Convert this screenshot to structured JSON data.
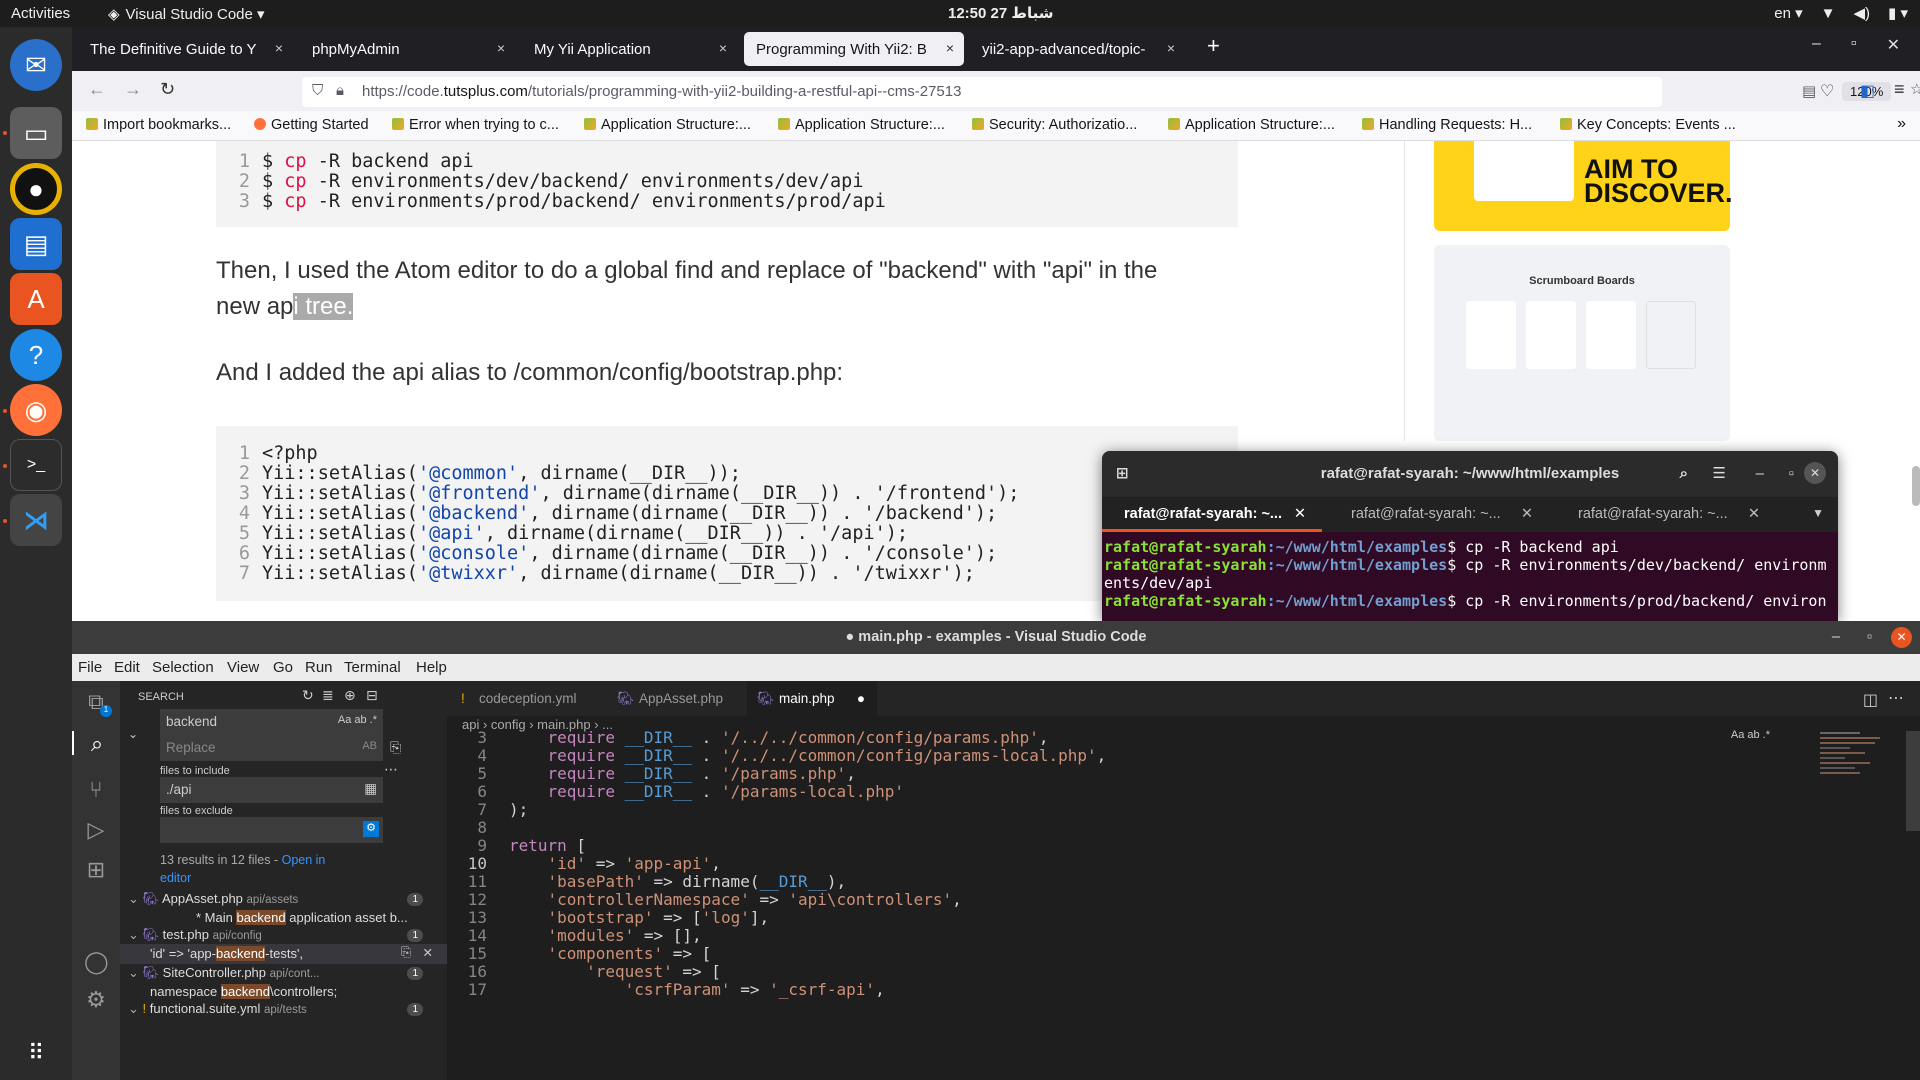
{
  "topbar": {
    "activities": "Activities",
    "app_name": "Visual Studio Code ▾",
    "clock": "12:50 27 شباط",
    "lang": "en ▾"
  },
  "firefox": {
    "tabs": [
      {
        "label": "The Definitive Guide to Y",
        "close": "×"
      },
      {
        "label": "phpMyAdmin",
        "close": "×"
      },
      {
        "label": "My Yii Application",
        "close": "×"
      },
      {
        "label": "Programming With Yii2: B",
        "close": "×"
      },
      {
        "label": "yii2-app-advanced/topic-",
        "close": "×"
      }
    ],
    "url_prefix": "https://code.",
    "url_domain": "tutsplus.com",
    "url_path": "/tutorials/programming-with-yii2-building-a-restful-api--cms-27513",
    "zoom": "120%",
    "bookmarks": [
      "Import bookmarks...",
      "Getting Started",
      "Error when trying to c...",
      "Application Structure:...",
      "Application Structure:...",
      "Security: Authorizatio...",
      "Application Structure:...",
      "Handling Requests: H...",
      "Key Concepts: Events ..."
    ]
  },
  "article": {
    "code1": [
      {
        "n": "1",
        "cmd": "cp",
        "args": " -R backend api"
      },
      {
        "n": "2",
        "cmd": "cp",
        "args": " -R environments/dev/backend/ environments/dev/api"
      },
      {
        "n": "3",
        "cmd": "cp",
        "args": " -R environments/prod/backend/ environments/prod/api"
      }
    ],
    "p1_a": "Then, I used the Atom editor to do a global find and replace of \"backend\" with \"api\" in the",
    "p1_b": "new ap",
    "p1_sel": "i tree.",
    "p2": "And I added the api alias to /common/config/bootstrap.php:",
    "code2": [
      {
        "n": "1",
        "pre": "<?php",
        "str": "",
        "post": ""
      },
      {
        "n": "2",
        "pre": "Yii::setAlias(",
        "str": "'@common'",
        "post": ", dirname(__DIR__));"
      },
      {
        "n": "3",
        "pre": "Yii::setAlias(",
        "str": "'@frontend'",
        "post": ", dirname(dirname(__DIR__)) . '/frontend');"
      },
      {
        "n": "4",
        "pre": "Yii::setAlias(",
        "str": "'@backend'",
        "post": ", dirname(dirname(__DIR__)) . '/backend');"
      },
      {
        "n": "5",
        "pre": "Yii::setAlias(",
        "str": "'@api'",
        "post": ", dirname(dirname(__DIR__)) . '/api');"
      },
      {
        "n": "6",
        "pre": "Yii::setAlias(",
        "str": "'@console'",
        "post": ", dirname(dirname(__DIR__)) . '/console');"
      },
      {
        "n": "7",
        "pre": "Yii::setAlias(",
        "str": "'@twixxr'",
        "post": ", dirname(dirname(__DIR__)) . '/twixxr');"
      }
    ],
    "ad1_text": "AIM TO DISCOVER.",
    "ad2_title": "Scrumboard Boards"
  },
  "terminal": {
    "title": "rafat@rafat-syarah: ~/www/html/examples",
    "tabs": [
      "rafat@rafat-syarah: ~...",
      "rafat@rafat-syarah: ~...",
      "rafat@rafat-syarah: ~..."
    ],
    "user": "rafat@rafat-syarah",
    "path": ":~/www/html/examples",
    "lines": [
      "$ cp -R backend api",
      "$ cp -R environments/dev/backend/ environm",
      "$ cp -R environments/prod/backend/ environ"
    ],
    "wrap": "ents/dev/api"
  },
  "vscode": {
    "title": "● main.php - examples - Visual Studio Code",
    "menu": [
      "File",
      "Edit",
      "Selection",
      "View",
      "Go",
      "Run",
      "Terminal",
      "Help"
    ],
    "search": {
      "header": "SEARCH",
      "query": "backend",
      "replace_placeholder": "Replace",
      "include_label": "files to include",
      "include_value": "./api",
      "exclude_label": "files to exclude",
      "summary": "13 results in 12 files - ",
      "open_editor": "Open in editor",
      "results": [
        {
          "file": "AppAsset.php",
          "path": "api/assets",
          "count": "1",
          "match_pre": "* Main ",
          "match_hl": "backend",
          "match_post": " application asset b..."
        },
        {
          "file": "test.php",
          "path": "api/config",
          "count": "1",
          "match_pre": "'id' => 'app-",
          "match_hl": "backend",
          "match_post": "-tests',"
        },
        {
          "file": "SiteController.php",
          "path": "api/cont...",
          "count": "1",
          "match_pre": "namespace ",
          "match_hl": "backend",
          "match_post": "\\controllers;"
        },
        {
          "file": "functional.suite.yml",
          "path": "api/tests",
          "count": "1",
          "match_pre": "",
          "match_hl": "",
          "match_post": ""
        }
      ]
    },
    "tabs": [
      "codeception.yml",
      "AppAsset.php",
      "main.php"
    ],
    "breadcrumb": "api  ›  config  ›  main.php  › ...",
    "code": [
      {
        "n": "3",
        "html": "    <span class='k'>require</span> <span class='c'>__DIR__</span> . <span class='s'>'/../../common/config/params.php'</span>,"
      },
      {
        "n": "4",
        "html": "    <span class='k'>require</span> <span class='c'>__DIR__</span> . <span class='s'>'/../../common/config/params-local.php'</span>,"
      },
      {
        "n": "5",
        "html": "    <span class='k'>require</span> <span class='c'>__DIR__</span> . <span class='s'>'/params.php'</span>,"
      },
      {
        "n": "6",
        "html": "    <span class='k'>require</span> <span class='c'>__DIR__</span> . <span class='s'>'/params-local.php'</span>"
      },
      {
        "n": "7",
        "html": ");"
      },
      {
        "n": "8",
        "html": ""
      },
      {
        "n": "9",
        "html": "<span class='k'>return</span> ["
      },
      {
        "n": "10",
        "html": "    <span class='s'>'id'</span> => <span class='s'>'app-api'</span>,"
      },
      {
        "n": "11",
        "html": "    <span class='s'>'basePath'</span> => dirname(<span class='c'>__DIR__</span>),"
      },
      {
        "n": "12",
        "html": "    <span class='s'>'controllerNamespace'</span> => <span class='s'>'api\\controllers'</span>,"
      },
      {
        "n": "13",
        "html": "    <span class='s'>'bootstrap'</span> => [<span class='s'>'log'</span>],"
      },
      {
        "n": "14",
        "html": "    <span class='s'>'modules'</span> => [],"
      },
      {
        "n": "15",
        "html": "    <span class='s'>'components'</span> => ["
      },
      {
        "n": "16",
        "html": "        <span class='s'>'request'</span> => ["
      },
      {
        "n": "17",
        "html": "            <span class='s'>'csrfParam'</span> => <span class='s'>'_csrf-api'</span>,"
      }
    ]
  }
}
